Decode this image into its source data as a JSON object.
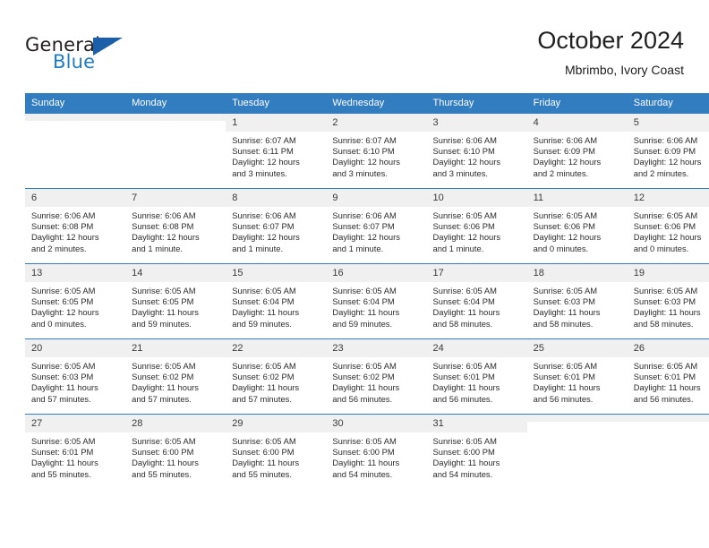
{
  "brand": {
    "word_one": "General",
    "word_two": "Blue",
    "mark": "triangle-logo",
    "accent_color": "#1b5fa8",
    "blue_text_color": "#1f7cc4"
  },
  "header": {
    "title": "October 2024",
    "subtitle": "Mbrimbo, Ivory Coast"
  },
  "theme": {
    "header_blue": "#327cc0",
    "daynum_band": "#f0f0f0"
  },
  "weekday_headers": [
    "Sunday",
    "Monday",
    "Tuesday",
    "Wednesday",
    "Thursday",
    "Friday",
    "Saturday"
  ],
  "weeks": [
    [
      {
        "day": "",
        "sunrise": "",
        "sunset": "",
        "daylight_line1": "",
        "daylight_line2": ""
      },
      {
        "day": "",
        "sunrise": "",
        "sunset": "",
        "daylight_line1": "",
        "daylight_line2": ""
      },
      {
        "day": "1",
        "sunrise": "Sunrise: 6:07 AM",
        "sunset": "Sunset: 6:11 PM",
        "daylight_line1": "Daylight: 12 hours",
        "daylight_line2": "and 3 minutes."
      },
      {
        "day": "2",
        "sunrise": "Sunrise: 6:07 AM",
        "sunset": "Sunset: 6:10 PM",
        "daylight_line1": "Daylight: 12 hours",
        "daylight_line2": "and 3 minutes."
      },
      {
        "day": "3",
        "sunrise": "Sunrise: 6:06 AM",
        "sunset": "Sunset: 6:10 PM",
        "daylight_line1": "Daylight: 12 hours",
        "daylight_line2": "and 3 minutes."
      },
      {
        "day": "4",
        "sunrise": "Sunrise: 6:06 AM",
        "sunset": "Sunset: 6:09 PM",
        "daylight_line1": "Daylight: 12 hours",
        "daylight_line2": "and 2 minutes."
      },
      {
        "day": "5",
        "sunrise": "Sunrise: 6:06 AM",
        "sunset": "Sunset: 6:09 PM",
        "daylight_line1": "Daylight: 12 hours",
        "daylight_line2": "and 2 minutes."
      }
    ],
    [
      {
        "day": "6",
        "sunrise": "Sunrise: 6:06 AM",
        "sunset": "Sunset: 6:08 PM",
        "daylight_line1": "Daylight: 12 hours",
        "daylight_line2": "and 2 minutes."
      },
      {
        "day": "7",
        "sunrise": "Sunrise: 6:06 AM",
        "sunset": "Sunset: 6:08 PM",
        "daylight_line1": "Daylight: 12 hours",
        "daylight_line2": "and 1 minute."
      },
      {
        "day": "8",
        "sunrise": "Sunrise: 6:06 AM",
        "sunset": "Sunset: 6:07 PM",
        "daylight_line1": "Daylight: 12 hours",
        "daylight_line2": "and 1 minute."
      },
      {
        "day": "9",
        "sunrise": "Sunrise: 6:06 AM",
        "sunset": "Sunset: 6:07 PM",
        "daylight_line1": "Daylight: 12 hours",
        "daylight_line2": "and 1 minute."
      },
      {
        "day": "10",
        "sunrise": "Sunrise: 6:05 AM",
        "sunset": "Sunset: 6:06 PM",
        "daylight_line1": "Daylight: 12 hours",
        "daylight_line2": "and 1 minute."
      },
      {
        "day": "11",
        "sunrise": "Sunrise: 6:05 AM",
        "sunset": "Sunset: 6:06 PM",
        "daylight_line1": "Daylight: 12 hours",
        "daylight_line2": "and 0 minutes."
      },
      {
        "day": "12",
        "sunrise": "Sunrise: 6:05 AM",
        "sunset": "Sunset: 6:06 PM",
        "daylight_line1": "Daylight: 12 hours",
        "daylight_line2": "and 0 minutes."
      }
    ],
    [
      {
        "day": "13",
        "sunrise": "Sunrise: 6:05 AM",
        "sunset": "Sunset: 6:05 PM",
        "daylight_line1": "Daylight: 12 hours",
        "daylight_line2": "and 0 minutes."
      },
      {
        "day": "14",
        "sunrise": "Sunrise: 6:05 AM",
        "sunset": "Sunset: 6:05 PM",
        "daylight_line1": "Daylight: 11 hours",
        "daylight_line2": "and 59 minutes."
      },
      {
        "day": "15",
        "sunrise": "Sunrise: 6:05 AM",
        "sunset": "Sunset: 6:04 PM",
        "daylight_line1": "Daylight: 11 hours",
        "daylight_line2": "and 59 minutes."
      },
      {
        "day": "16",
        "sunrise": "Sunrise: 6:05 AM",
        "sunset": "Sunset: 6:04 PM",
        "daylight_line1": "Daylight: 11 hours",
        "daylight_line2": "and 59 minutes."
      },
      {
        "day": "17",
        "sunrise": "Sunrise: 6:05 AM",
        "sunset": "Sunset: 6:04 PM",
        "daylight_line1": "Daylight: 11 hours",
        "daylight_line2": "and 58 minutes."
      },
      {
        "day": "18",
        "sunrise": "Sunrise: 6:05 AM",
        "sunset": "Sunset: 6:03 PM",
        "daylight_line1": "Daylight: 11 hours",
        "daylight_line2": "and 58 minutes."
      },
      {
        "day": "19",
        "sunrise": "Sunrise: 6:05 AM",
        "sunset": "Sunset: 6:03 PM",
        "daylight_line1": "Daylight: 11 hours",
        "daylight_line2": "and 58 minutes."
      }
    ],
    [
      {
        "day": "20",
        "sunrise": "Sunrise: 6:05 AM",
        "sunset": "Sunset: 6:03 PM",
        "daylight_line1": "Daylight: 11 hours",
        "daylight_line2": "and 57 minutes."
      },
      {
        "day": "21",
        "sunrise": "Sunrise: 6:05 AM",
        "sunset": "Sunset: 6:02 PM",
        "daylight_line1": "Daylight: 11 hours",
        "daylight_line2": "and 57 minutes."
      },
      {
        "day": "22",
        "sunrise": "Sunrise: 6:05 AM",
        "sunset": "Sunset: 6:02 PM",
        "daylight_line1": "Daylight: 11 hours",
        "daylight_line2": "and 57 minutes."
      },
      {
        "day": "23",
        "sunrise": "Sunrise: 6:05 AM",
        "sunset": "Sunset: 6:02 PM",
        "daylight_line1": "Daylight: 11 hours",
        "daylight_line2": "and 56 minutes."
      },
      {
        "day": "24",
        "sunrise": "Sunrise: 6:05 AM",
        "sunset": "Sunset: 6:01 PM",
        "daylight_line1": "Daylight: 11 hours",
        "daylight_line2": "and 56 minutes."
      },
      {
        "day": "25",
        "sunrise": "Sunrise: 6:05 AM",
        "sunset": "Sunset: 6:01 PM",
        "daylight_line1": "Daylight: 11 hours",
        "daylight_line2": "and 56 minutes."
      },
      {
        "day": "26",
        "sunrise": "Sunrise: 6:05 AM",
        "sunset": "Sunset: 6:01 PM",
        "daylight_line1": "Daylight: 11 hours",
        "daylight_line2": "and 56 minutes."
      }
    ],
    [
      {
        "day": "27",
        "sunrise": "Sunrise: 6:05 AM",
        "sunset": "Sunset: 6:01 PM",
        "daylight_line1": "Daylight: 11 hours",
        "daylight_line2": "and 55 minutes."
      },
      {
        "day": "28",
        "sunrise": "Sunrise: 6:05 AM",
        "sunset": "Sunset: 6:00 PM",
        "daylight_line1": "Daylight: 11 hours",
        "daylight_line2": "and 55 minutes."
      },
      {
        "day": "29",
        "sunrise": "Sunrise: 6:05 AM",
        "sunset": "Sunset: 6:00 PM",
        "daylight_line1": "Daylight: 11 hours",
        "daylight_line2": "and 55 minutes."
      },
      {
        "day": "30",
        "sunrise": "Sunrise: 6:05 AM",
        "sunset": "Sunset: 6:00 PM",
        "daylight_line1": "Daylight: 11 hours",
        "daylight_line2": "and 54 minutes."
      },
      {
        "day": "31",
        "sunrise": "Sunrise: 6:05 AM",
        "sunset": "Sunset: 6:00 PM",
        "daylight_line1": "Daylight: 11 hours",
        "daylight_line2": "and 54 minutes."
      },
      {
        "day": "",
        "sunrise": "",
        "sunset": "",
        "daylight_line1": "",
        "daylight_line2": ""
      },
      {
        "day": "",
        "sunrise": "",
        "sunset": "",
        "daylight_line1": "",
        "daylight_line2": ""
      }
    ]
  ]
}
